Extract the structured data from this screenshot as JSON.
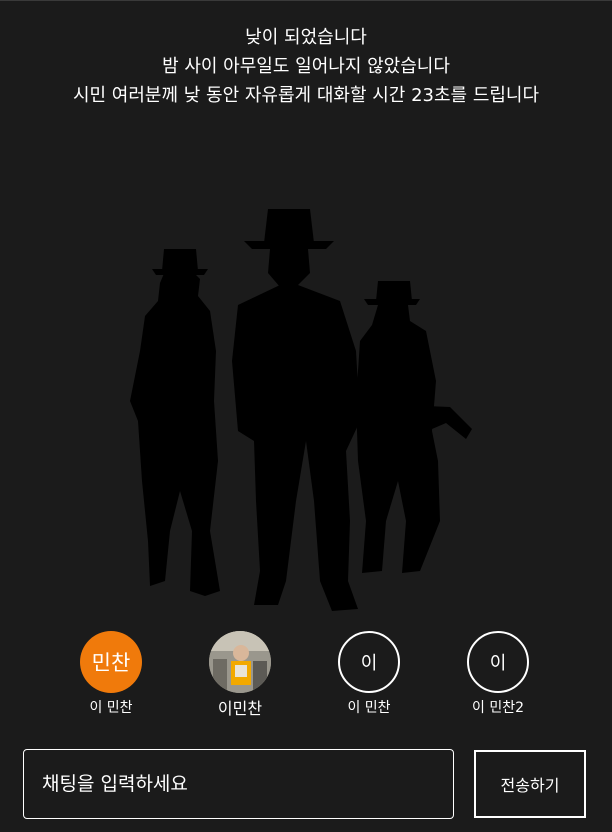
{
  "announcement": {
    "line1": "낮이 되었습니다",
    "line2": "밤 사이 아무일도 일어나지 않았습니다",
    "line3": "시민 여러분께 낮 동안 자유롭게 대화할 시간 23초를 드립니다"
  },
  "players": [
    {
      "avatar_text": "민찬",
      "name": "이 민찬",
      "avatar_style": "orange"
    },
    {
      "avatar_text": "",
      "name": "이민찬",
      "avatar_style": "photo"
    },
    {
      "avatar_text": "이",
      "name": "이 민찬",
      "avatar_style": "outline"
    },
    {
      "avatar_text": "이",
      "name": "이 민찬2",
      "avatar_style": "outline"
    }
  ],
  "chat": {
    "placeholder": "채팅을 입력하세요",
    "send_label": "전송하기"
  },
  "colors": {
    "background": "#1b1b1b",
    "accent": "#f07a0b",
    "text": "#ffffff"
  }
}
